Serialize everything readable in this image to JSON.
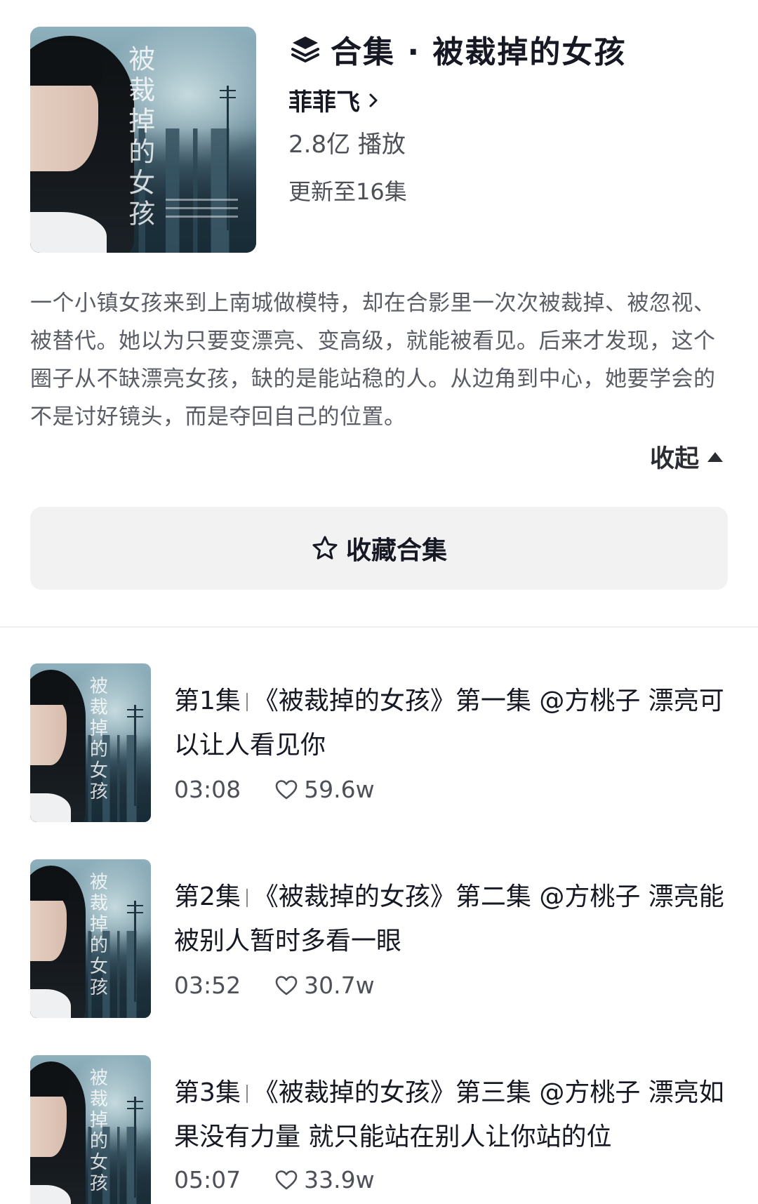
{
  "collection": {
    "title": "合集 · 被裁掉的女孩",
    "cover_title": "被裁掉的女孩",
    "author": "菲菲飞",
    "plays": "2.8亿 播放",
    "update_status": "更新至16集",
    "description": "一个小镇女孩来到上南城做模特，却在合影里一次次被裁掉、被忽视、被替代。她以为只要变漂亮、变高级，就能被看见。后来才发现，这个圈子从不缺漂亮女孩，缺的是能站稳的人。从边角到中心，她要学会的不是讨好镜头，而是夺回自己的位置。",
    "collapse_label": "收起",
    "favorite_label": "收藏合集",
    "icons": {
      "title": "layers-icon",
      "author_link": "chevron-right-icon",
      "collapse": "triangle-up-icon",
      "favorite": "star-outline-icon",
      "likes": "heart-outline-icon"
    }
  },
  "episodes": [
    {
      "number": "第1集",
      "title": "《被裁掉的女孩》第一集 @方桃子 漂亮可以让人看见你",
      "duration": "03:08",
      "likes": "59.6w"
    },
    {
      "number": "第2集",
      "title": "《被裁掉的女孩》第二集 @方桃子 漂亮能被别人暂时多看一眼",
      "duration": "03:52",
      "likes": "30.7w"
    },
    {
      "number": "第3集",
      "title": "《被裁掉的女孩》第三集 @方桃子 漂亮如果没有力量 就只能站在别人让你站的位",
      "duration": "05:07",
      "likes": "33.9w"
    }
  ]
}
